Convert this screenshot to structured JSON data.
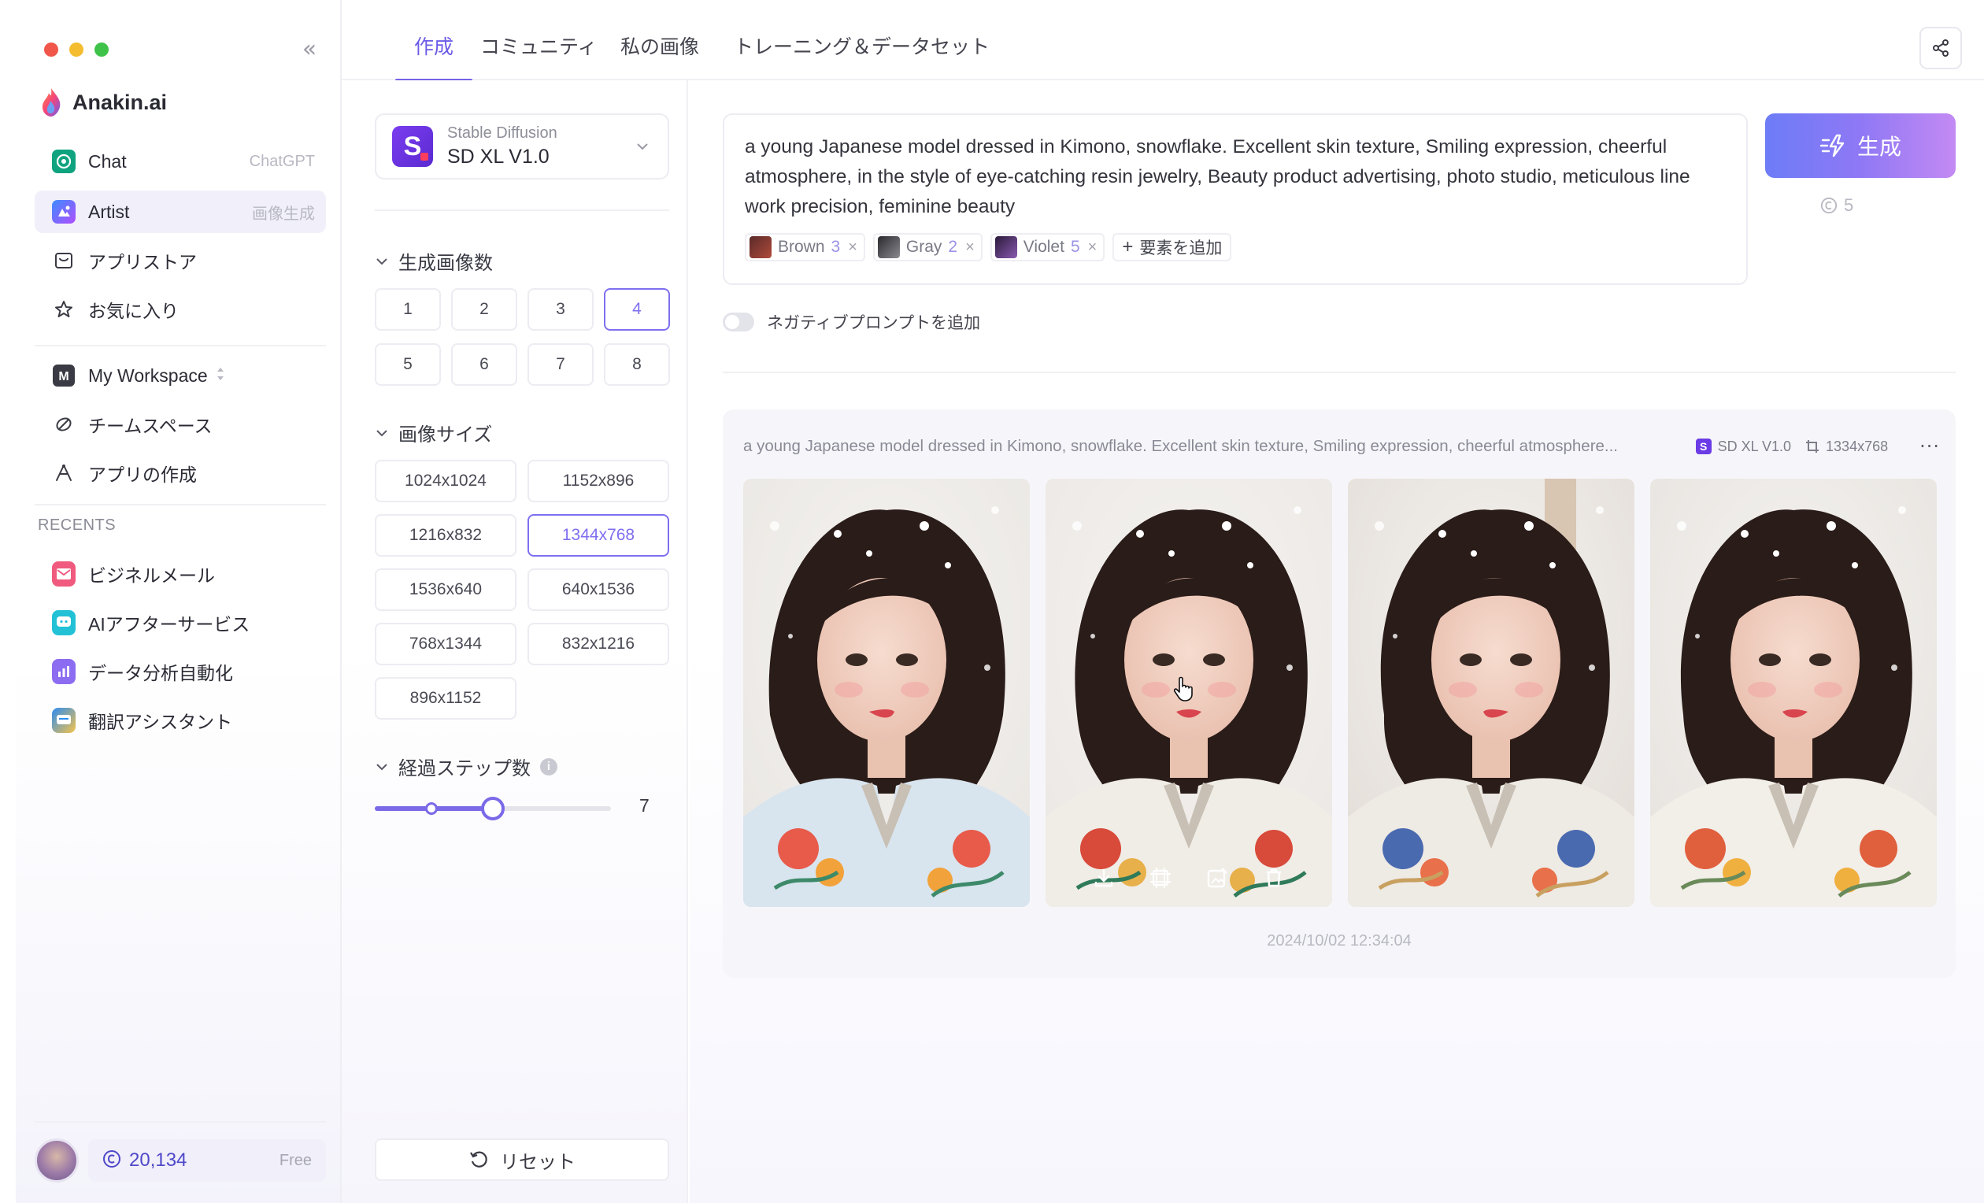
{
  "window": {
    "collapse_glyph": "«"
  },
  "brand": {
    "name": "Anakin.ai"
  },
  "sidebar": {
    "nav": [
      {
        "label": "Chat",
        "hint": "ChatGPT",
        "icon": "chatgpt-icon"
      },
      {
        "label": "Artist",
        "hint": "画像生成",
        "icon": "artist-icon"
      },
      {
        "label": "アプリストア",
        "hint": "",
        "icon": "store-icon"
      },
      {
        "label": "お気に入り",
        "hint": "",
        "icon": "star-icon"
      }
    ],
    "workspace": {
      "label": "My Workspace",
      "badge": "M",
      "items": [
        {
          "label": "チームスペース",
          "icon": "team-icon"
        },
        {
          "label": "アプリの作成",
          "icon": "create-app-icon"
        }
      ]
    },
    "recents_title": "RECENTS",
    "recents": [
      {
        "label": "ビジネルメール",
        "color": "#f05a7e"
      },
      {
        "label": "AIアフターサービス",
        "color": "#22c1d6"
      },
      {
        "label": "データ分析自動化",
        "color": "#8c6cf0"
      },
      {
        "label": "翻訳アシスタント",
        "color": "#2e8cf0"
      }
    ],
    "credits": "20,134",
    "plan": "Free"
  },
  "tabs": [
    {
      "label": "作成",
      "active": true
    },
    {
      "label": "コミュニティ",
      "active": false
    },
    {
      "label": "私の画像",
      "active": false
    },
    {
      "label": "トレーニング＆データセット",
      "active": false
    }
  ],
  "settings": {
    "model": {
      "provider": "Stable Diffusion",
      "name": "SD XL V1.0",
      "logo_letter": "S"
    },
    "count_title": "生成画像数",
    "counts": [
      "1",
      "2",
      "3",
      "4",
      "5",
      "6",
      "7",
      "8"
    ],
    "count_selected": "4",
    "size_title": "画像サイズ",
    "sizes": [
      "1024x1024",
      "1152x896",
      "1216x832",
      "1344x768",
      "1536x640",
      "640x1536",
      "768x1344",
      "832x1216",
      "896x1152"
    ],
    "size_selected": "1344x768",
    "steps_title": "経過ステップ数",
    "steps_value": "7",
    "steps_fraction": 0.5,
    "reset_label": "リセット"
  },
  "prompt": {
    "text": "a young Japanese model dressed in Kimono, snowflake. Excellent skin texture, Smiling expression, cheerful atmosphere, in the style of eye-catching resin jewelry, Beauty product advertising, photo studio, meticulous line work precision, feminine beauty",
    "chips": [
      {
        "name": "Brown",
        "count": "3"
      },
      {
        "name": "Gray",
        "count": "2"
      },
      {
        "name": "Violet",
        "count": "5"
      }
    ],
    "add_element": "要素を追加",
    "generate_label": "生成",
    "cost": "5",
    "negative_label": "ネガティブプロンプトを追加"
  },
  "result": {
    "prompt_preview": "a young Japanese model dressed in Kimono, snowflake. Excellent skin texture, Smiling expression, cheerful atmosphere...",
    "model_tag": "SD XL V1.0",
    "size_tag": "1334x768",
    "timestamp": "2024/10/02 12:34:04",
    "images": [
      {
        "alt": "portrait-1",
        "bg": "#e9e6e2"
      },
      {
        "alt": "portrait-2",
        "bg": "#ebe7e4"
      },
      {
        "alt": "portrait-3",
        "bg": "#e2dcd6"
      },
      {
        "alt": "portrait-4",
        "bg": "#e6e2de"
      }
    ],
    "tools": [
      "download-icon",
      "upscale-icon",
      "edit-image-icon",
      "trash-icon"
    ]
  },
  "colors": {
    "accent": "#7563ea",
    "generate_start": "#6d7cf7",
    "generate_end": "#c38af3"
  }
}
